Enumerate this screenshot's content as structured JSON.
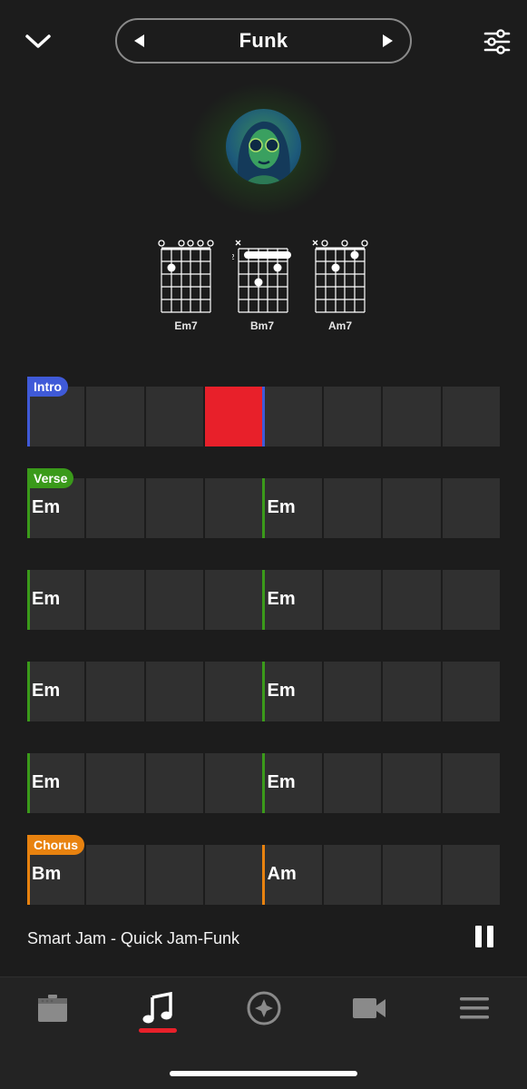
{
  "header": {
    "title": "Funk",
    "back_icon": "chevron-down-icon",
    "prev_icon": "triangle-left-icon",
    "next_icon": "triangle-right-icon",
    "settings_icon": "sliders-icon"
  },
  "chords": [
    {
      "name": "Em7"
    },
    {
      "name": "Bm7",
      "fret_label": "2"
    },
    {
      "name": "Am7"
    }
  ],
  "sections": [
    {
      "tag": "Intro",
      "color": "#3f5ad8",
      "chords": [
        "",
        ""
      ]
    },
    {
      "tag": "Verse",
      "color": "#3a9a1a",
      "chords": [
        "Em",
        "Em"
      ]
    },
    {
      "tag": "",
      "color": "#3a9a1a",
      "chords": [
        "Em",
        "Em"
      ]
    },
    {
      "tag": "",
      "color": "#3a9a1a",
      "chords": [
        "Em",
        "Em"
      ]
    },
    {
      "tag": "",
      "color": "#3a9a1a",
      "chords": [
        "Em",
        "Em"
      ]
    },
    {
      "tag": "Chorus",
      "color": "#e8820f",
      "chords": [
        "Bm",
        "Am"
      ]
    }
  ],
  "playhead": {
    "section": 1,
    "beat": 4
  },
  "now_playing": {
    "title": "Smart Jam - Quick Jam-Funk",
    "state_icon": "pause-icon"
  },
  "tabbar": {
    "items": [
      {
        "icon": "amp-icon"
      },
      {
        "icon": "music-note-icon",
        "selected": true
      },
      {
        "icon": "compass-icon"
      },
      {
        "icon": "video-camera-icon"
      },
      {
        "icon": "menu-icon"
      }
    ]
  },
  "colors": {
    "accent": "#e8202a",
    "intro": "#3f5ad8",
    "verse": "#3a9a1a",
    "chorus": "#e8820f"
  }
}
